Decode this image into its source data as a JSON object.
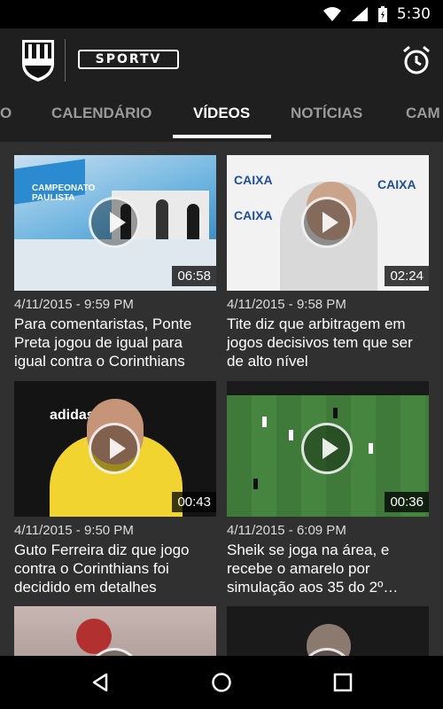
{
  "status": {
    "time": "5:30"
  },
  "app": {
    "club_badge_text": "A.A.P.P.",
    "logo_text": "SPORTV"
  },
  "tabs": [
    {
      "label": "O"
    },
    {
      "label": "CALENDÁRIO"
    },
    {
      "label": "VÍDEOS"
    },
    {
      "label": "NOTÍCIAS"
    },
    {
      "label": "CAM"
    }
  ],
  "videos": [
    {
      "duration": "06:58",
      "date": "4/11/2015 - 9:59 PM",
      "title": "Para comentaristas, Ponte Preta jogou de igual para igual contra o Corinthians",
      "thumb_text": "CAMPEONATO PAULISTA"
    },
    {
      "duration": "02:24",
      "date": "4/11/2015 - 9:58 PM",
      "title": "Tite diz que arbitragem em jogos decisivos tem que ser de alto nível",
      "thumb_text": "CAIXA"
    },
    {
      "duration": "00:43",
      "date": "4/11/2015 - 9:50 PM",
      "title": "Guto Ferreira diz que jogo contra o Corinthians foi decidido em detalhes",
      "thumb_text": "adidas"
    },
    {
      "duration": "00:36",
      "date": "4/11/2015 - 6:09 PM",
      "title": "Sheik se joga na área, e recebe o amarelo por simulação aos 35 do 2º…",
      "thumb_text": ""
    },
    {
      "duration": "",
      "date": "",
      "title": ""
    },
    {
      "duration": "",
      "date": "",
      "title": ""
    }
  ],
  "colors": {
    "background": "#303030",
    "appbar": "#1f1f1f",
    "tab_inactive": "#9a9a9a"
  }
}
